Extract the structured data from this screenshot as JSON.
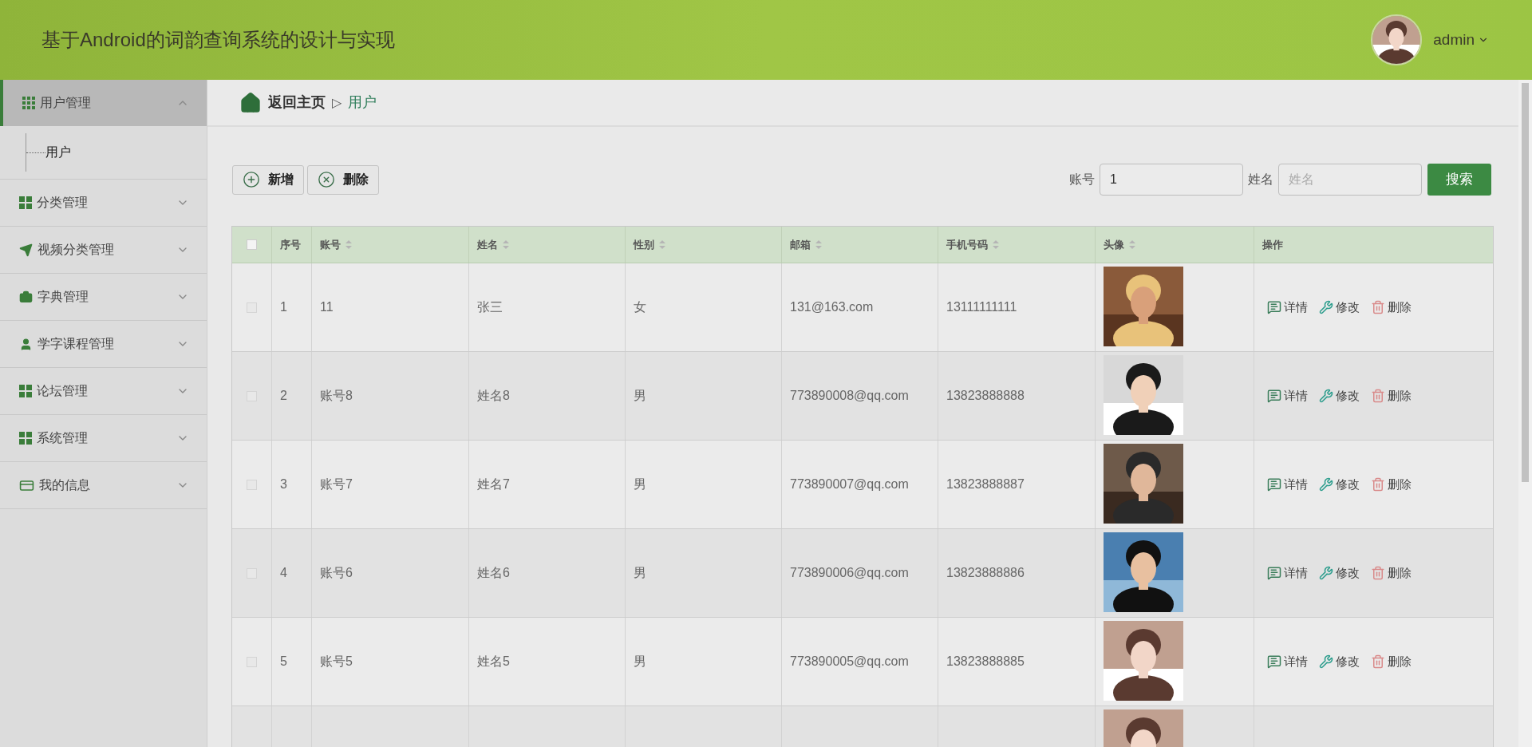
{
  "header": {
    "title": "基于Android的词韵查询系统的设计与实现",
    "user": "admin",
    "avatar": {
      "kind": "picture"
    }
  },
  "sidebar": {
    "items": [
      {
        "label": "用户管理",
        "kind": "grid9",
        "expanded": true,
        "selected": true,
        "children": [
          {
            "label": "用户"
          }
        ]
      },
      {
        "label": "分类管理",
        "kind": "grid4",
        "expanded": false,
        "selected": false
      },
      {
        "label": "视频分类管理",
        "kind": "plane",
        "expanded": false,
        "selected": false
      },
      {
        "label": "字典管理",
        "kind": "briefcase",
        "expanded": false,
        "selected": false
      },
      {
        "label": "学字课程管理",
        "kind": "person",
        "expanded": false,
        "selected": false
      },
      {
        "label": "论坛管理",
        "kind": "grid4",
        "expanded": false,
        "selected": false
      },
      {
        "label": "系统管理",
        "kind": "grid4",
        "expanded": false,
        "selected": false
      },
      {
        "label": "我的信息",
        "kind": "card",
        "expanded": false,
        "selected": false
      }
    ]
  },
  "breadcrumb": {
    "home": "返回主页",
    "separator": "▷",
    "current": "用户"
  },
  "toolbar": {
    "buttons": [
      {
        "label": "新增",
        "kind": "add"
      },
      {
        "label": "删除",
        "kind": "remove"
      }
    ],
    "filters": [
      {
        "label": "账号",
        "value": "1"
      },
      {
        "label": "姓名",
        "placeholder": "姓名"
      }
    ],
    "search": "搜索"
  },
  "table": {
    "all_checked": false,
    "columns": [
      {
        "label": "序号",
        "sortable": false
      },
      {
        "label": "账号",
        "sortable": true
      },
      {
        "label": "姓名",
        "sortable": true
      },
      {
        "label": "性别",
        "sortable": true
      },
      {
        "label": "邮箱",
        "sortable": true
      },
      {
        "label": "手机号码",
        "sortable": true
      },
      {
        "label": "头像",
        "sortable": true
      },
      {
        "label": "操作",
        "sortable": false
      }
    ],
    "rows": [
      {
        "checked": false,
        "cells": [
          "1",
          "11",
          "张三",
          "女",
          "131@163.com",
          "13111111111"
        ],
        "avatar": {
          "kind": "picture"
        },
        "actions": [
          "详情",
          "修改",
          "删除"
        ]
      },
      {
        "checked": false,
        "cells": [
          "2",
          "账号8",
          "姓名8",
          "男",
          "773890008@qq.com",
          "13823888888"
        ],
        "avatar": {
          "kind": "picture"
        },
        "actions": [
          "详情",
          "修改",
          "删除"
        ]
      },
      {
        "checked": false,
        "cells": [
          "3",
          "账号7",
          "姓名7",
          "男",
          "773890007@qq.com",
          "13823888887"
        ],
        "avatar": {
          "kind": "picture"
        },
        "actions": [
          "详情",
          "修改",
          "删除"
        ]
      },
      {
        "checked": false,
        "cells": [
          "4",
          "账号6",
          "姓名6",
          "男",
          "773890006@qq.com",
          "13823888886"
        ],
        "avatar": {
          "kind": "picture"
        },
        "actions": [
          "详情",
          "修改",
          "删除"
        ]
      },
      {
        "checked": false,
        "cells": [
          "5",
          "账号5",
          "姓名5",
          "男",
          "773890005@qq.com",
          "13823888885"
        ],
        "avatar": {
          "kind": "picture"
        },
        "actions": [
          "详情",
          "修改",
          "删除"
        ]
      },
      {
        "avatar": {
          "kind": "picture"
        }
      }
    ]
  }
}
